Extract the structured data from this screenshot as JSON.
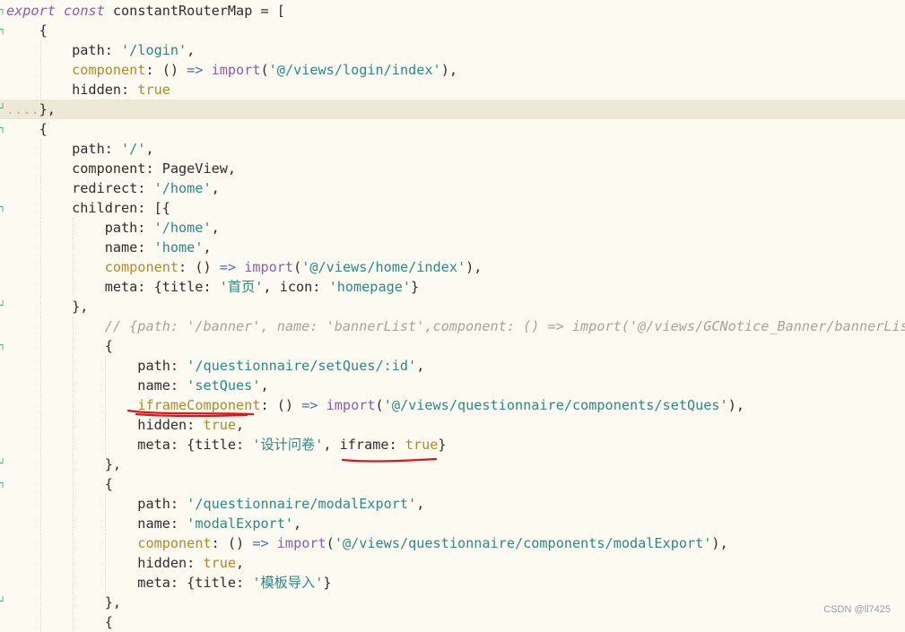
{
  "editor": {
    "lines": [
      {
        "gutter": "┐",
        "tokens": [
          {
            "t": "export",
            "c": "kwi"
          },
          {
            "t": " ",
            "c": "plain"
          },
          {
            "t": "const",
            "c": "kwi"
          },
          {
            "t": " constantRouterMap = [",
            "c": "plain"
          }
        ]
      },
      {
        "gutter": "┐",
        "tokens": [
          {
            "t": "    {",
            "c": "plain"
          }
        ]
      },
      {
        "gutter": "",
        "tokens": [
          {
            "t": "        path: ",
            "c": "plain"
          },
          {
            "t": "'/login'",
            "c": "str"
          },
          {
            "t": ",",
            "c": "plain"
          }
        ]
      },
      {
        "gutter": "",
        "tokens": [
          {
            "t": "        ",
            "c": "plain"
          },
          {
            "t": "component",
            "c": "prop"
          },
          {
            "t": ": () ",
            "c": "plain"
          },
          {
            "t": "=>",
            "c": "arrow"
          },
          {
            "t": " ",
            "c": "plain"
          },
          {
            "t": "import",
            "c": "kw"
          },
          {
            "t": "(",
            "c": "plain"
          },
          {
            "t": "'@/views/login/index'",
            "c": "str"
          },
          {
            "t": "),",
            "c": "plain"
          }
        ]
      },
      {
        "gutter": "",
        "tokens": [
          {
            "t": "        hidden: ",
            "c": "plain"
          },
          {
            "t": "true",
            "c": "bool"
          }
        ]
      },
      {
        "gutter": "┘",
        "highlight": true,
        "tokens": [
          {
            "t": "....",
            "c": "dots"
          },
          {
            "t": "},",
            "c": "plain"
          }
        ]
      },
      {
        "gutter": "┐",
        "tokens": [
          {
            "t": "    {",
            "c": "plain"
          }
        ]
      },
      {
        "gutter": "",
        "tokens": [
          {
            "t": "        path: ",
            "c": "plain"
          },
          {
            "t": "'/'",
            "c": "str"
          },
          {
            "t": ",",
            "c": "plain"
          }
        ]
      },
      {
        "gutter": "",
        "tokens": [
          {
            "t": "        component: PageView,",
            "c": "plain"
          }
        ]
      },
      {
        "gutter": "",
        "tokens": [
          {
            "t": "        redirect: ",
            "c": "plain"
          },
          {
            "t": "'/home'",
            "c": "str"
          },
          {
            "t": ",",
            "c": "plain"
          }
        ]
      },
      {
        "gutter": "┐",
        "tokens": [
          {
            "t": "        children: [{",
            "c": "plain"
          }
        ]
      },
      {
        "gutter": "",
        "tokens": [
          {
            "t": "            path: ",
            "c": "plain"
          },
          {
            "t": "'/home'",
            "c": "str"
          },
          {
            "t": ",",
            "c": "plain"
          }
        ]
      },
      {
        "gutter": "",
        "tokens": [
          {
            "t": "            name: ",
            "c": "plain"
          },
          {
            "t": "'home'",
            "c": "str"
          },
          {
            "t": ",",
            "c": "plain"
          }
        ]
      },
      {
        "gutter": "",
        "tokens": [
          {
            "t": "            ",
            "c": "plain"
          },
          {
            "t": "component",
            "c": "prop"
          },
          {
            "t": ": () ",
            "c": "plain"
          },
          {
            "t": "=>",
            "c": "arrow"
          },
          {
            "t": " ",
            "c": "plain"
          },
          {
            "t": "import",
            "c": "kw"
          },
          {
            "t": "(",
            "c": "plain"
          },
          {
            "t": "'@/views/home/index'",
            "c": "str"
          },
          {
            "t": "),",
            "c": "plain"
          }
        ]
      },
      {
        "gutter": "",
        "tokens": [
          {
            "t": "            meta: {title: ",
            "c": "plain"
          },
          {
            "t": "'首页'",
            "c": "str"
          },
          {
            "t": ", icon: ",
            "c": "plain"
          },
          {
            "t": "'homepage'",
            "c": "str"
          },
          {
            "t": "}",
            "c": "plain"
          }
        ]
      },
      {
        "gutter": "┘",
        "tokens": [
          {
            "t": "        },",
            "c": "plain"
          }
        ]
      },
      {
        "gutter": "",
        "tokens": [
          {
            "t": "            // {path: '/banner', name: 'bannerList',component: () => import('@/views/GCNotice_Banner/bannerList",
            "c": "cmt"
          }
        ]
      },
      {
        "gutter": "┐",
        "tokens": [
          {
            "t": "            {",
            "c": "plain"
          }
        ]
      },
      {
        "gutter": "",
        "tokens": [
          {
            "t": "                path: ",
            "c": "plain"
          },
          {
            "t": "'/questionnaire/setQues/:id'",
            "c": "str"
          },
          {
            "t": ",",
            "c": "plain"
          }
        ]
      },
      {
        "gutter": "",
        "tokens": [
          {
            "t": "                name: ",
            "c": "plain"
          },
          {
            "t": "'setQues'",
            "c": "str"
          },
          {
            "t": ",",
            "c": "plain"
          }
        ]
      },
      {
        "gutter": "",
        "tokens": [
          {
            "t": "                ",
            "c": "plain"
          },
          {
            "t": "iframeComponent",
            "c": "prop"
          },
          {
            "t": ": () ",
            "c": "plain"
          },
          {
            "t": "=>",
            "c": "arrow"
          },
          {
            "t": " ",
            "c": "plain"
          },
          {
            "t": "import",
            "c": "kw"
          },
          {
            "t": "(",
            "c": "plain"
          },
          {
            "t": "'@/views/questionnaire/components/setQues'",
            "c": "str"
          },
          {
            "t": "),",
            "c": "plain"
          }
        ]
      },
      {
        "gutter": "",
        "tokens": [
          {
            "t": "                hidden: ",
            "c": "plain"
          },
          {
            "t": "true",
            "c": "bool"
          },
          {
            "t": ",",
            "c": "plain"
          }
        ]
      },
      {
        "gutter": "",
        "tokens": [
          {
            "t": "                meta: {title: ",
            "c": "plain"
          },
          {
            "t": "'设计问卷'",
            "c": "str"
          },
          {
            "t": ", iframe: ",
            "c": "plain"
          },
          {
            "t": "true",
            "c": "bool"
          },
          {
            "t": "}",
            "c": "plain"
          }
        ]
      },
      {
        "gutter": "┘",
        "tokens": [
          {
            "t": "            },",
            "c": "plain"
          }
        ]
      },
      {
        "gutter": "┐",
        "tokens": [
          {
            "t": "            {",
            "c": "plain"
          }
        ]
      },
      {
        "gutter": "",
        "tokens": [
          {
            "t": "                path: ",
            "c": "plain"
          },
          {
            "t": "'/questionnaire/modalExport'",
            "c": "str"
          },
          {
            "t": ",",
            "c": "plain"
          }
        ]
      },
      {
        "gutter": "",
        "tokens": [
          {
            "t": "                name: ",
            "c": "plain"
          },
          {
            "t": "'modalExport'",
            "c": "str"
          },
          {
            "t": ",",
            "c": "plain"
          }
        ]
      },
      {
        "gutter": "",
        "tokens": [
          {
            "t": "                ",
            "c": "plain"
          },
          {
            "t": "component",
            "c": "prop"
          },
          {
            "t": ": () ",
            "c": "plain"
          },
          {
            "t": "=>",
            "c": "arrow"
          },
          {
            "t": " ",
            "c": "plain"
          },
          {
            "t": "import",
            "c": "kw"
          },
          {
            "t": "(",
            "c": "plain"
          },
          {
            "t": "'@/views/questionnaire/components/modalExport'",
            "c": "str"
          },
          {
            "t": "),",
            "c": "plain"
          }
        ]
      },
      {
        "gutter": "",
        "tokens": [
          {
            "t": "                hidden: ",
            "c": "plain"
          },
          {
            "t": "true",
            "c": "bool"
          },
          {
            "t": ",",
            "c": "plain"
          }
        ]
      },
      {
        "gutter": "",
        "tokens": [
          {
            "t": "                meta: {title: ",
            "c": "plain"
          },
          {
            "t": "'模板导入'",
            "c": "str"
          },
          {
            "t": "}",
            "c": "plain"
          }
        ]
      },
      {
        "gutter": "┘",
        "tokens": [
          {
            "t": "            },",
            "c": "plain"
          }
        ]
      },
      {
        "gutter": "",
        "tokens": [
          {
            "t": "            {",
            "c": "plain"
          }
        ]
      }
    ]
  },
  "annotations": {
    "underline_color": "#e0141e",
    "underlined_tokens": [
      "iframeComponent",
      "iframe: true"
    ]
  },
  "watermark": "CSDN @ll7425"
}
